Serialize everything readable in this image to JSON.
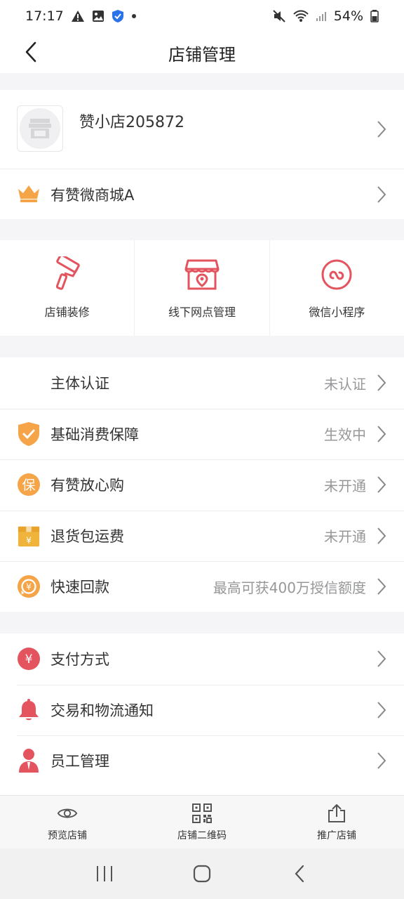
{
  "status_bar": {
    "time": "17:17",
    "battery": "54%"
  },
  "nav": {
    "title": "店铺管理"
  },
  "shop": {
    "name": "赞小店205872",
    "plan": "有赞微商城A"
  },
  "tools": [
    {
      "label": "店铺装修",
      "icon": "paint-roller-icon"
    },
    {
      "label": "线下网点管理",
      "icon": "store-location-icon"
    },
    {
      "label": "微信小程序",
      "icon": "mini-program-icon"
    }
  ],
  "services": [
    {
      "label": "主体认证",
      "value": "未认证",
      "icon": ""
    },
    {
      "label": "基础消费保障",
      "value": "生效中",
      "icon": "shield-check-icon"
    },
    {
      "label": "有赞放心购",
      "value": "未开通",
      "icon": "guarantee-badge-icon"
    },
    {
      "label": "退货包运费",
      "value": "未开通",
      "icon": "shipping-box-icon"
    },
    {
      "label": "快速回款",
      "value": "最高可获400万授信额度",
      "icon": "fast-payment-icon"
    }
  ],
  "settings": [
    {
      "label": "支付方式",
      "icon": "yuan-circle-icon"
    },
    {
      "label": "交易和物流通知",
      "icon": "bell-icon"
    },
    {
      "label": "员工管理",
      "icon": "staff-icon"
    }
  ],
  "bottom_bar": {
    "preview": "预览店铺",
    "qrcode": "店铺二维码",
    "promote": "推广店铺"
  },
  "colors": {
    "accent_red": "#e4545e",
    "orange": "#f5a447",
    "gold": "#f0b33c"
  }
}
